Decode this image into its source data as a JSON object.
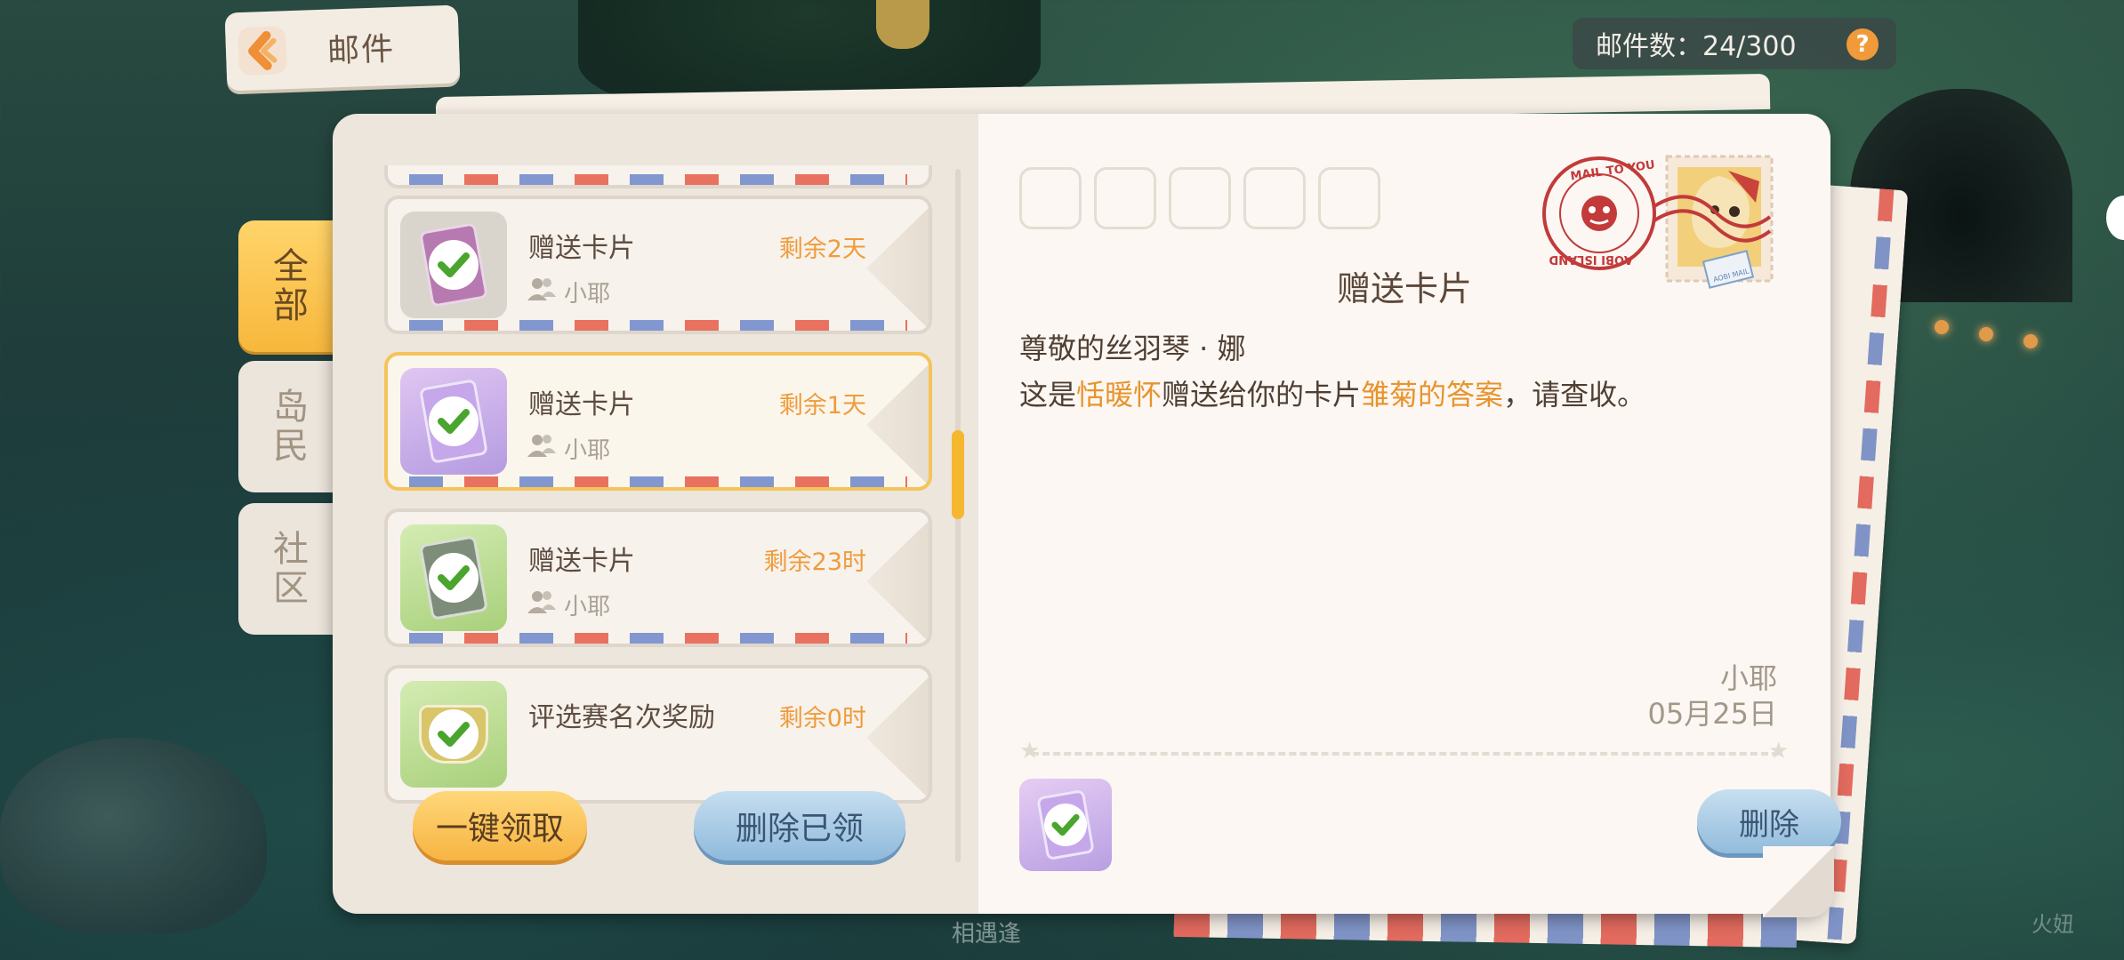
{
  "header": {
    "back_title": "邮件",
    "mail_count_label": "邮件数：24/300",
    "help_label": "?"
  },
  "tabs": [
    {
      "label": "全部",
      "active": true
    },
    {
      "label": "岛民",
      "active": false
    },
    {
      "label": "社区",
      "active": false
    }
  ],
  "mail_list": [
    {
      "title": "赠送卡片",
      "sender": "小耶",
      "remaining": "剩余2天",
      "thumb": "gray",
      "selected": false
    },
    {
      "title": "赠送卡片",
      "sender": "小耶",
      "remaining": "剩余1天",
      "thumb": "purple",
      "selected": true
    },
    {
      "title": "赠送卡片",
      "sender": "小耶",
      "remaining": "剩余23时",
      "thumb": "green",
      "selected": false
    },
    {
      "title": "评选赛名次奖励",
      "sender": "",
      "remaining": "剩余0时",
      "thumb": "green",
      "selected": false
    }
  ],
  "actions": {
    "claim_all": "一键领取",
    "delete_read": "删除已领"
  },
  "letter": {
    "title": "赠送卡片",
    "greeting": "尊敬的丝羽琴 · 娜",
    "body_prefix": "这是",
    "giver": "恬暖怀",
    "body_mid": "赠送给你的卡片",
    "card_name": "雏菊的答案",
    "body_suffix": "，请查收。",
    "sender": "小耶",
    "date": "05月25日",
    "delete_label": "删除"
  },
  "stamp": {
    "postmark_top": "MAIL TO YOU",
    "postmark_bottom": "AOBI ISLAND",
    "airmail": "AOBI MAIL"
  },
  "overlay": {
    "watermark": "火妞",
    "bottom_text": "相遇逢"
  },
  "colors": {
    "accent": "#f5b630",
    "highlight": "#e8942d",
    "remaining": "#ef9b3a"
  }
}
